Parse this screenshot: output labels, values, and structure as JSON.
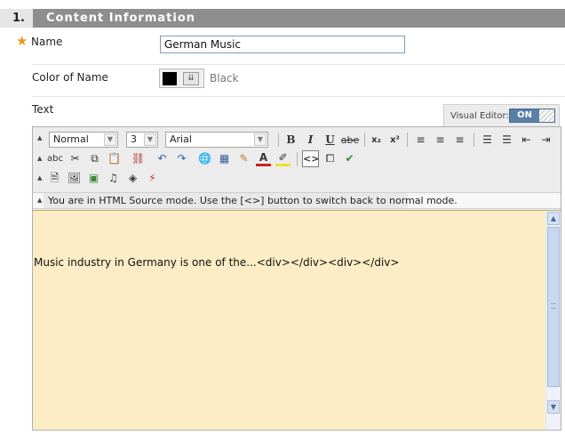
{
  "section": {
    "number": "1.",
    "title": "Content Information"
  },
  "name_field": {
    "required_marker": "★",
    "label": "Name",
    "value": "German Music"
  },
  "color_field": {
    "label": "Color of Name",
    "swatch_color": "#000000",
    "value_label": "Black"
  },
  "text_field": {
    "label": "Text"
  },
  "visual_editor": {
    "label": "Visual Editor:",
    "state": "ON"
  },
  "toolbar": {
    "format_select": "Normal",
    "size_select": "3",
    "font_select": "Arial",
    "bold": "B",
    "italic": "I",
    "underline": "U",
    "strike": "abe"
  },
  "mode_message": "You are in HTML Source mode. Use the [<>] button to switch back to normal mode.",
  "editor_content": "Music industry in Germany is one of the...<div></div><div></div>"
}
